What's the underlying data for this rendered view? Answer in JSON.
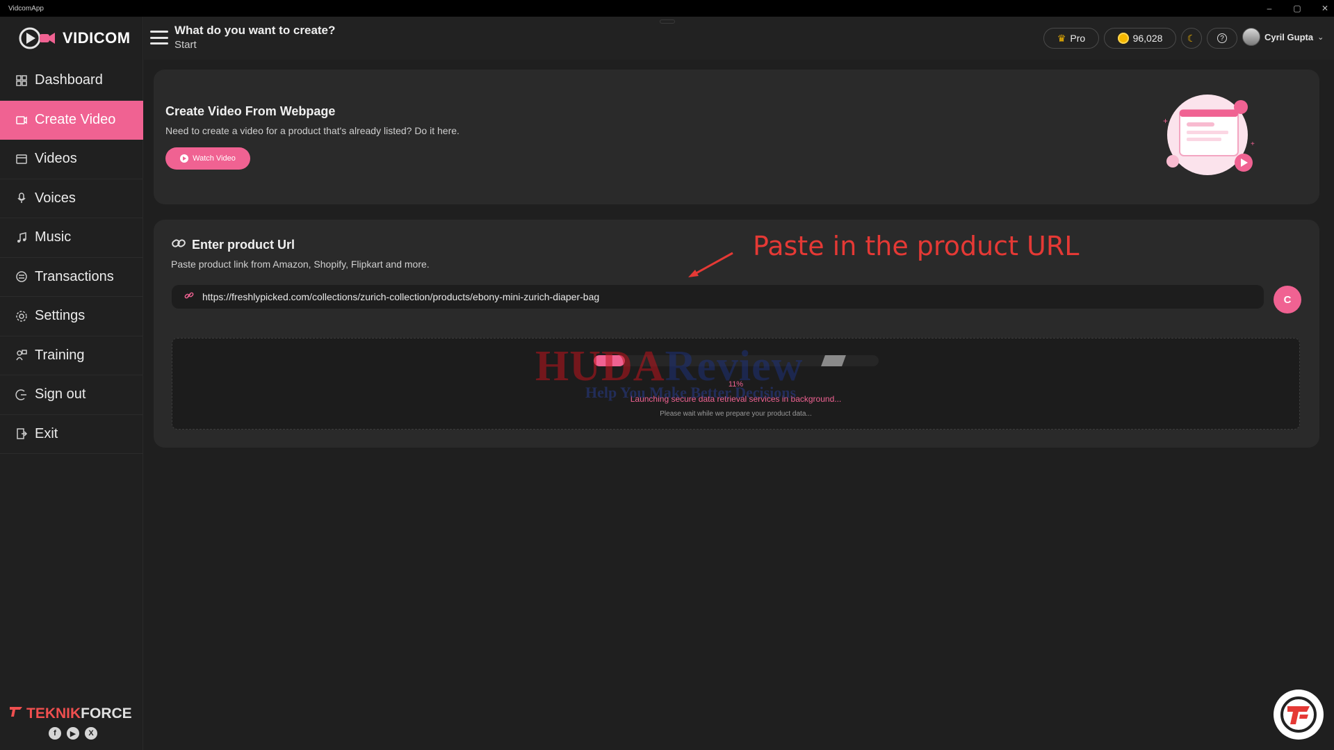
{
  "window": {
    "title": "VidcomApp"
  },
  "brand": {
    "name": "VIDICOM",
    "footer_left": "TEKNIK",
    "footer_right": "FORCE"
  },
  "nav": {
    "items": [
      {
        "label": "Dashboard",
        "icon": "dashboard-icon"
      },
      {
        "label": "Create Video",
        "icon": "create-video-icon",
        "active": true
      },
      {
        "label": "Videos",
        "icon": "videos-icon"
      },
      {
        "label": "Voices",
        "icon": "microphone-icon"
      },
      {
        "label": "Music",
        "icon": "music-icon"
      },
      {
        "label": "Transactions",
        "icon": "transactions-icon"
      },
      {
        "label": "Settings",
        "icon": "gear-icon"
      },
      {
        "label": "Training",
        "icon": "training-icon"
      },
      {
        "label": "Sign out",
        "icon": "sign-out-icon"
      },
      {
        "label": "Exit",
        "icon": "exit-icon"
      }
    ]
  },
  "header": {
    "title": "What do you want to create?",
    "subtitle": "Start",
    "plan": "Pro",
    "credits": "96,028",
    "user_name": "Cyril Gupta"
  },
  "webpage_card": {
    "title": "Create Video From Webpage",
    "description": "Need to create a video for a product that's already listed? Do it here.",
    "button": "Watch Video"
  },
  "url_card": {
    "title": "Enter product Url",
    "description": "Paste product link from Amazon, Shopify, Flipkart and more.",
    "url_value": "https://freshlypicked.com/collections/zurich-collection/products/ebony-mini-zurich-diaper-bag",
    "go_label": "C"
  },
  "progress": {
    "percent": 11,
    "percent_label": "11%",
    "status": "Launching secure data retrieval services in background...",
    "wait": "Please wait while we prepare your product data..."
  },
  "watermark": {
    "line1_red": "HUDA",
    "line1_blue": "Review",
    "line2": "Help You Make Better Decisions"
  },
  "annotation": "Paste in the product URL",
  "colors": {
    "accent": "#f06292",
    "background": "#1f1f1f",
    "card": "#2a2a2a",
    "annotation": "#e53935"
  }
}
